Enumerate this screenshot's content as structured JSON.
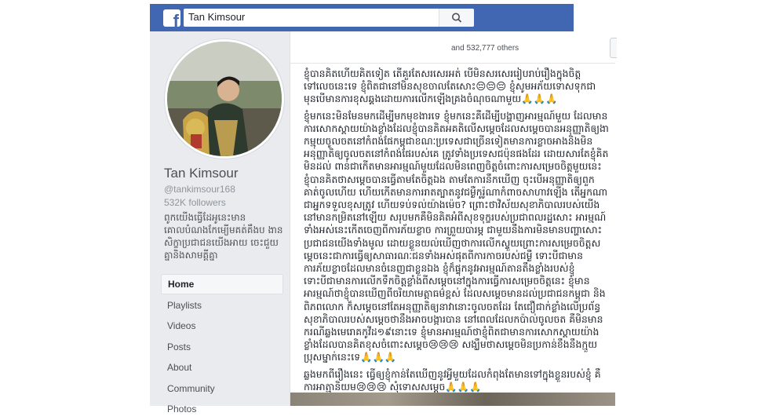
{
  "header": {
    "logo": "f",
    "search_value": "Tan Kimsour",
    "search_icon": "search-icon"
  },
  "sidebar": {
    "name": "Tan Kimsour",
    "handle": "@tankimsour168",
    "followers": "532K followers",
    "bio": "ពូកយេីងធ្វេីដែអូនេះមាន គោលបំណងកែម្យើមគត់គឹងប ងានសិក្ខាប្រជាជនយេីងអាយ ចេះជួយគ្នានិងសាមគ្គីគ្នា",
    "nav": [
      {
        "label": "Home",
        "active": true
      },
      {
        "label": "Playlists"
      },
      {
        "label": "Videos"
      },
      {
        "label": "Posts"
      },
      {
        "label": "About"
      },
      {
        "label": "Community"
      },
      {
        "label": "Photos"
      }
    ]
  },
  "feed": {
    "likes_text": "and 532,777 others",
    "post": {
      "p1": "ខ្ញុំបានគិតហើយគិតទៀត តើគួរតែសរសេរអត់ បើមិនសរសេររៀបរាប់រឿងក្នុងចិត្តទៅលេចនេះទេ ខ្ញុំពិតជានៅមិនសុខចាលតែសោះ😔😔😔 ខ្ញុំសូមអភ័យទោសទុកជាមុនបើមានការខុសឆ្គងដោយការលើកឡើងគ្រងចំណុចណាមួយ🙏🙏🙏",
      "p2": "ខ្ញុំមកនេះមិនមែនមកដើម្បីមកមុខងារទេ ខ្ញុំមកនេះគឺដើម្បីបង្ហាញអារម្មណ៍មួយ ដែលមានការសោកស្តាយយ៉ាងខ្លាំងដែលខ្ញុំបានគិតអគតិលើសម្តេចដែលសម្តេចបានអនុញ្ញាតិឲ្យងាកម្មុយចូលចតនៅកំពង់ផែកម្ពុជាខណៈប្រទេសជាច្រើនទៀតមានការខ្លាចអាងនិងមិនអនុញ្ញាតិឲ្យចូលចតនៅកំពង់ផែរបស់គេ ត្រូវទាំងប្រទេសជប៉ុនផងដែរ ដោយសារតែខ្ញុំគិតមិនដល់ ពាន់ជាកើតមានអារម្មណ៍មួយដែលមិនពេញចិត្តចំពោះការសម្រេចចិត្តមួយនេះ ខ្ញុំបានគិតថាសម្តេចបានធ្វើតាមតែចិត្តឯង តាមតែការនឹកឃើញ ចុះបើអនុញ្ញាតិឲ្យពួកគាត់ចូលហើយ ហើយកើតមានការរាតត្បាតនូវជម្ងឺកូរ៉ូណាកំពាចសាហាវឡើង តើអ្នកណាជាអ្នកទទួលខុសត្រូវ ហើយទប់ទល់យ៉ាងម៉េច? ព្រោះថាវិស័យសុខាភិបាលរបស់យើងនៅមានកម្រិតនៅឡើយ សរុបមកគឺមិនគិតអំពីសុខទុក្ខរបស់ប្រជាពលរដ្ឋសោះ អារម្មណ៍ទាំងអស់នេះកើតចេញពីការភ័យខ្លាច ការព្រួយបារម្ភ ជាមួយនឹងការមិនមានបញ្ហាសោះប្រជាជនយេីងទាំងមូល ដោយខ្លួនយល់ឃើញថាការលើកស្ទួយព្រោះការសម្រេចចិត្តសម្តេចនេះជាការធ្វើឲ្យសាធារណៈជនទាំងអស់ផុតពីការកាចរបស់ជម្ងឺ ទោះបីជាមានការភ័យខ្លាចដែលមានចំនេញជាខ្លួនឯង ខ្ញុំក៏ផ្ទុកនូវអារម្មណ៍តានតឹងខ្លាំងរបស់ខ្ញុំ ទោះបីជាមានការលើកទឹកចិត្តខ្លាំងពីសម្តេចនៅក្នុងការធ្វើការសម្រេចចិត្តនេះ ខ្ញុំមានអារម្មណ៍ថាខ្ញុំបានឃើញពីចរិយាមេត្តាធម៌ខ្ពស់ ដែលសម្តេចមានដល់ប្រជាជនកម្ពុជា និងពិភពលោក ក៏សម្តេចនៅតែអនុញ្ញាតិឲ្យនាវានោះចូលចតដែរ តែជឿជាក់ខ្លាំងលើប្រព័ន្ធសុខាភិបាលរបស់សម្តេចថានឹងអាចបង្ការបាន នៅពេលដែលកប៉ាល់ចូលចត គឺមិនមានករណីឆ្លងមេរោគកូវីដ១៩នោះទេ ខ្ញុំមានអារម្មណ៍ថាខ្ញុំពិតជាមានការសោកស្តាយយ៉ាងខ្លាំងដែលបានគិតខុសចំពោះសម្តេច😢😢😢 សង្ឃឹមថាសម្តេចមិនប្រកាន់ខឹងនឹងក្មួយប្រុសម្នាក់នេះទេ🙏🙏🙏",
      "p3": "ឆ្លងមកពីរឿងនេះ ធ្វើឲ្យខ្ញុំកាន់តែឃើញនូវអ្វីមួយដែលកំពុងតែមានទៅក្នុងខ្លួនរបស់ខ្ញុំ គឺការអាត្មានិយម😢😢😢 សុំទោសសម្តេច🙏🙏🙏"
    }
  },
  "colors": {
    "brand": "#4267b2",
    "page_bg": "#e9ebee"
  }
}
